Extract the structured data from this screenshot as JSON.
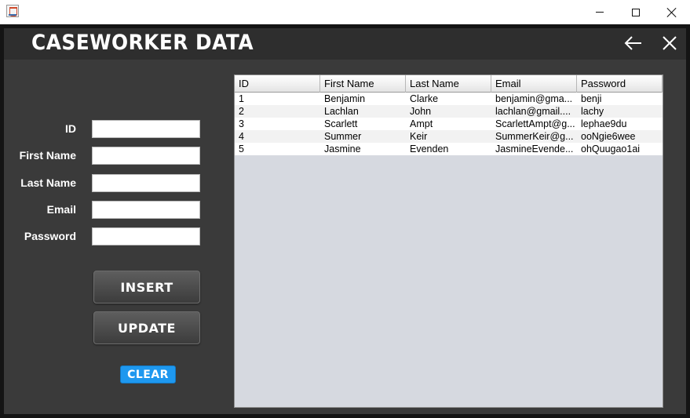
{
  "window": {
    "app_icon": "java-cup-icon",
    "minimize_icon": "minimize-icon",
    "maximize_icon": "maximize-icon",
    "close_icon": "close-icon"
  },
  "header": {
    "title": "CASEWORKER DATA",
    "back_icon": "arrow-left-icon",
    "close_icon": "close-icon"
  },
  "form": {
    "fields": [
      {
        "label": "ID",
        "value": ""
      },
      {
        "label": "First Name",
        "value": ""
      },
      {
        "label": "Last Name",
        "value": ""
      },
      {
        "label": "Email",
        "value": ""
      },
      {
        "label": "Password",
        "value": ""
      }
    ],
    "insert_label": "INSERT",
    "update_label": "UPDATE",
    "clear_label": "CLEAR"
  },
  "table": {
    "columns": [
      "ID",
      "First Name",
      "Last Name",
      "Email",
      "Password"
    ],
    "rows": [
      [
        "1",
        "Benjamin",
        "Clarke",
        "benjamin@gma...",
        "benji"
      ],
      [
        "2",
        "Lachlan",
        "John",
        "lachlan@gmail....",
        "lachy"
      ],
      [
        "3",
        "Scarlett",
        "Ampt",
        "ScarlettAmpt@g...",
        "lephae9du"
      ],
      [
        "4",
        "Summer",
        "Keir",
        "SummerKeir@g...",
        " ooNgie6wee"
      ],
      [
        "5",
        "Jasmine",
        "Evenden",
        "JasmineEvende...",
        "ohQuugao1ai"
      ]
    ]
  },
  "colors": {
    "app_background": "#3a3a3a",
    "header_background": "#2e2e2e",
    "table_background": "#d6d9e0",
    "clear_button": "#1e98ef"
  }
}
